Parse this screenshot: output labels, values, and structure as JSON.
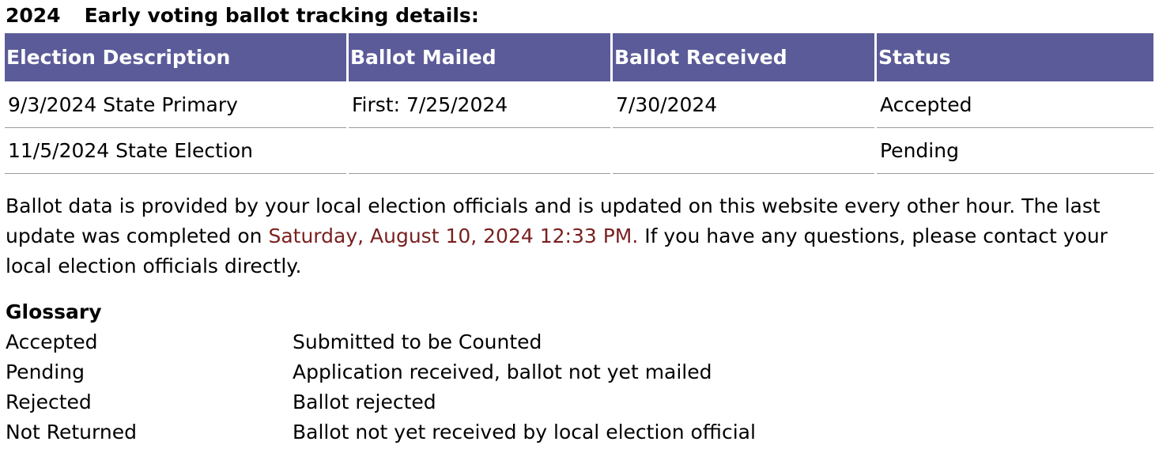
{
  "header": {
    "year": "2024",
    "title": "Early voting ballot tracking details:"
  },
  "table": {
    "columns": [
      "Election Description",
      "Ballot Mailed",
      "Ballot Received",
      "Status"
    ],
    "rows": [
      {
        "election": "9/3/2024 State Primary",
        "mailed": "First: 7/25/2024",
        "received": "7/30/2024",
        "status": "Accepted"
      },
      {
        "election": "11/5/2024 State Election",
        "mailed": "",
        "received": "",
        "status": "Pending"
      }
    ]
  },
  "info": {
    "text_before": "Ballot data is provided by your local election officials and is updated on this website every other hour. The last update was completed on ",
    "last_update": "Saturday, August 10, 2024 12:33 PM.",
    "text_after": " If you have any questions, please contact your local election officials directly."
  },
  "glossary": {
    "title": "Glossary",
    "items": [
      {
        "term": "Accepted",
        "definition": "Submitted to be Counted"
      },
      {
        "term": "Pending",
        "definition": "Application received, ballot not yet mailed"
      },
      {
        "term": "Rejected",
        "definition": "Ballot rejected"
      },
      {
        "term": "Not Returned",
        "definition": "Ballot not yet received by local election official"
      }
    ]
  },
  "colors": {
    "header_bg": "#5b5b99",
    "header_text": "#ffffff",
    "date_text": "#7a1f1f",
    "row_divider": "#9a9a9a"
  }
}
